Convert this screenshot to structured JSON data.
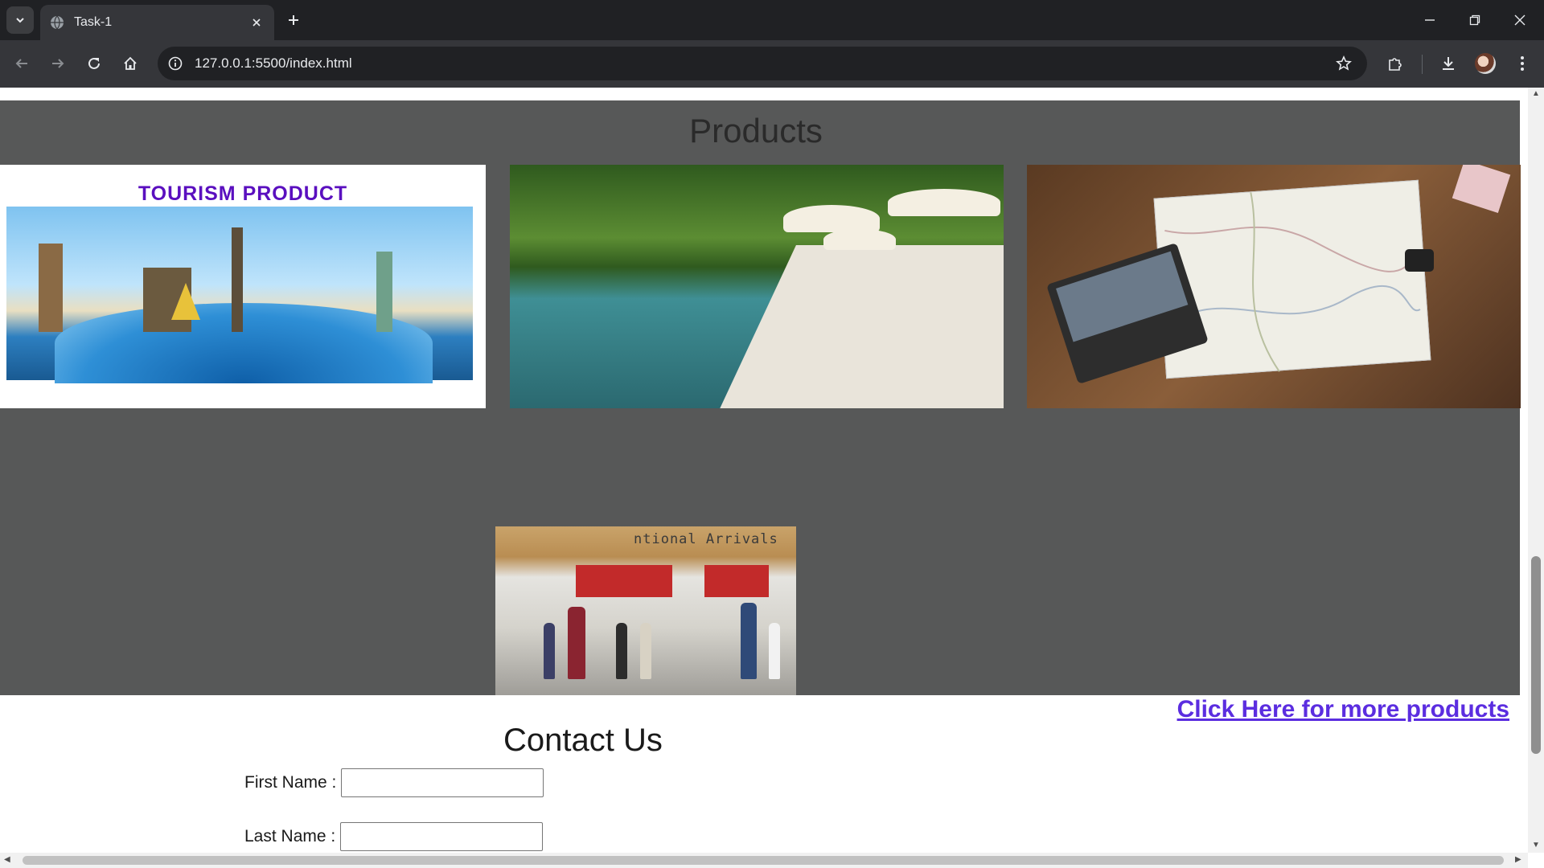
{
  "browser": {
    "tab_title": "Task-1",
    "url": "127.0.0.1:5500/index.html",
    "icons": [
      "tab-search-icon",
      "globe-icon",
      "close-icon",
      "new-tab-icon",
      "minimize-icon",
      "restore-icon",
      "window-close-icon",
      "back-icon",
      "forward-icon",
      "reload-icon",
      "home-icon",
      "site-info-icon",
      "bookmark-star-icon",
      "extensions-icon",
      "download-icon",
      "profile-avatar",
      "menu-icon"
    ]
  },
  "products": {
    "title": "Products",
    "image1_caption": "TOURISM PRODUCT",
    "image4_sign": "ntional Arrivals",
    "more_link": "Click Here for more products"
  },
  "contact": {
    "title": "Contact Us",
    "first_name_label": "First Name :",
    "last_name_label": "Last Name :",
    "first_name_value": "",
    "last_name_value": ""
  },
  "colors": {
    "chrome_dark": "#202124",
    "chrome_toolbar": "#35363a",
    "products_bg": "#575858",
    "link": "#5b2de0"
  }
}
